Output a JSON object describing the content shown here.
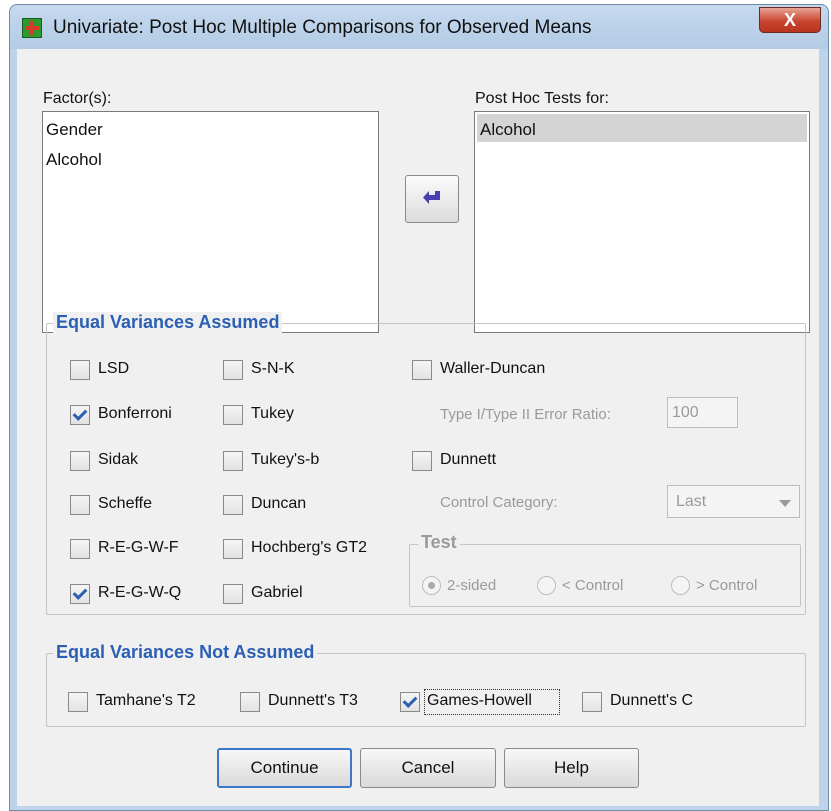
{
  "window": {
    "title": "Univariate: Post Hoc Multiple Comparisons for Observed Means",
    "close_label": "X"
  },
  "factors": {
    "label": "Factor(s):",
    "items": [
      "Gender",
      "Alcohol"
    ]
  },
  "move_button_icon": "arrow-left-icon",
  "post_hoc": {
    "label": "Post Hoc Tests for:",
    "items": [
      "Alcohol"
    ]
  },
  "equal_assumed": {
    "title": "Equal Variances Assumed",
    "checks": [
      {
        "label": "LSD",
        "checked": false
      },
      {
        "label": "Bonferroni",
        "checked": true
      },
      {
        "label": "Sidak",
        "checked": false
      },
      {
        "label": "Scheffe",
        "checked": false
      },
      {
        "label": "R-E-G-W-F",
        "checked": false
      },
      {
        "label": "R-E-G-W-Q",
        "checked": true
      },
      {
        "label": "S-N-K",
        "checked": false
      },
      {
        "label": "Tukey",
        "checked": false
      },
      {
        "label": "Tukey's-b",
        "checked": false
      },
      {
        "label": "Duncan",
        "checked": false
      },
      {
        "label": "Hochberg's GT2",
        "checked": false
      },
      {
        "label": "Gabriel",
        "checked": false
      },
      {
        "label": "Waller-Duncan",
        "checked": false
      },
      {
        "label": "Dunnett",
        "checked": false
      }
    ],
    "error_ratio_label": "Type I/Type II Error Ratio:",
    "error_ratio_value": "100",
    "control_category_label": "Control Category:",
    "control_category_value": "Last",
    "test_title": "Test",
    "test_options": [
      {
        "label": "2-sided",
        "selected": true
      },
      {
        "label": "< Control",
        "selected": false
      },
      {
        "label": "> Control",
        "selected": false
      }
    ]
  },
  "not_assumed": {
    "title": "Equal Variances Not Assumed",
    "checks": [
      {
        "label": "Tamhane's T2",
        "checked": false
      },
      {
        "label": "Dunnett's T3",
        "checked": false
      },
      {
        "label": "Games-Howell",
        "checked": true
      },
      {
        "label": "Dunnett's C",
        "checked": false
      }
    ]
  },
  "buttons": {
    "continue": "Continue",
    "cancel": "Cancel",
    "help": "Help"
  },
  "colors": {
    "group_title": "#2b5fb4",
    "arrow": "#4a3fb0"
  }
}
